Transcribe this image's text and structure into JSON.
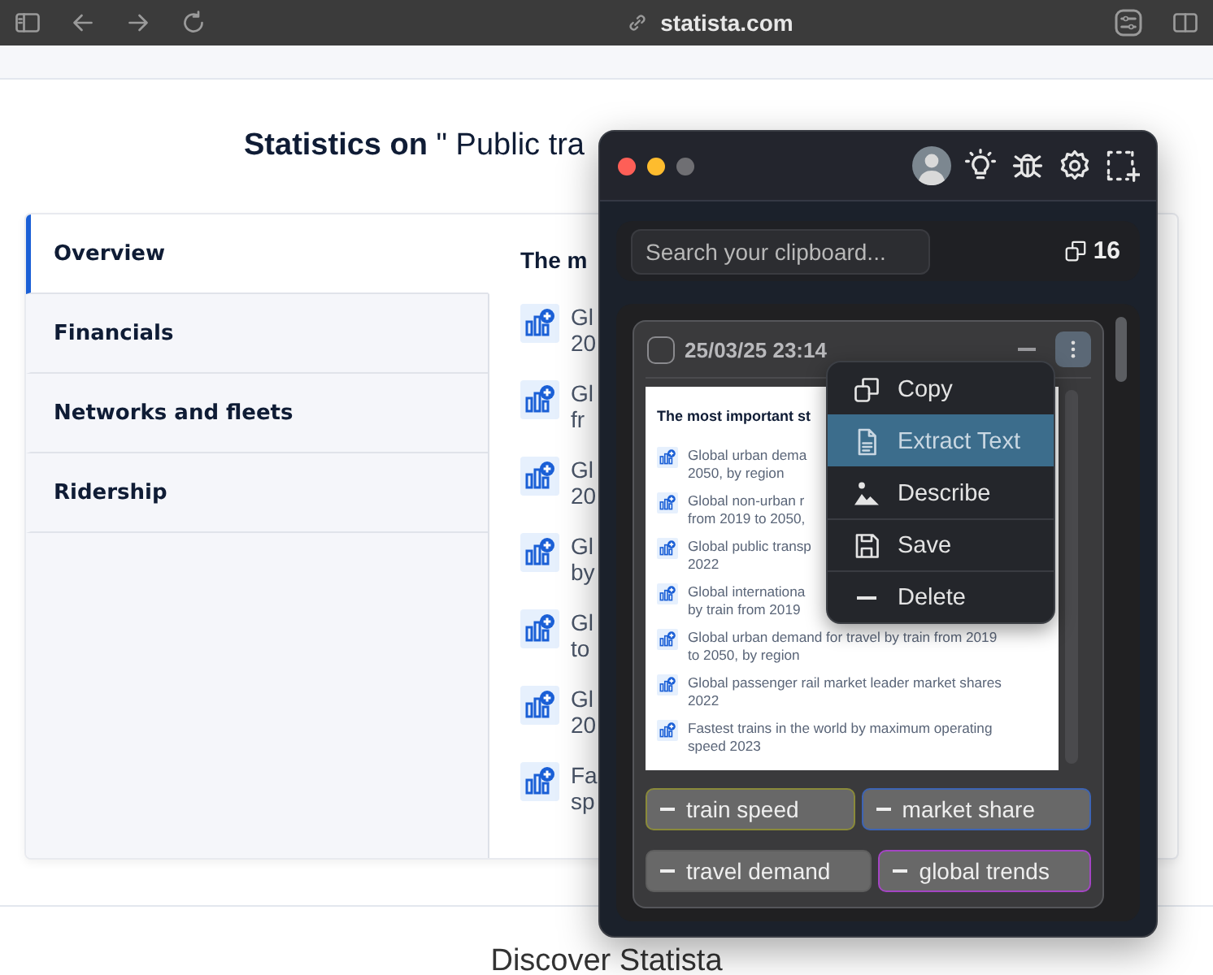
{
  "browser": {
    "url": "statista.com"
  },
  "page": {
    "title": "**Statistics on** \" Public tra",
    "content_heading": "The m",
    "footer_heading": "Discover Statista"
  },
  "tabs": [
    {
      "label": "Overview",
      "selected": true
    },
    {
      "label": "Financials",
      "selected": false
    },
    {
      "label": "Networks and fleets",
      "selected": false
    },
    {
      "label": "Ridership",
      "selected": false
    }
  ],
  "content_items": [
    {
      "lines": [
        "Gl",
        "20"
      ]
    },
    {
      "lines": [
        "Gl",
        "fr"
      ]
    },
    {
      "lines": [
        "Gl",
        "20"
      ]
    },
    {
      "lines": [
        "Gl",
        "by"
      ]
    },
    {
      "lines": [
        "Gl",
        "to"
      ]
    },
    {
      "lines": [
        "Gl",
        "20"
      ]
    },
    {
      "lines": [
        "Fa",
        "sp"
      ]
    }
  ],
  "clipboard": {
    "search": {
      "placeholder": "Search your clipboard..."
    },
    "count": "16",
    "entry": {
      "checked": false,
      "timestamp": "25/03/25 23:14",
      "preview": {
        "heading": "The most important st",
        "items": [
          {
            "lines": [
              "Global urban dema",
              "2050, by region"
            ]
          },
          {
            "lines": [
              "Global non-urban r",
              "from 2019 to 2050,"
            ]
          },
          {
            "lines": [
              "Global public transp",
              "2022"
            ]
          },
          {
            "lines": [
              "Global internationa",
              "by train from 2019"
            ]
          },
          {
            "lines": [
              "Global urban demand for travel by train from 2019",
              "to 2050, by region"
            ]
          },
          {
            "lines": [
              "Global passenger rail market leader market shares",
              "2022"
            ]
          },
          {
            "lines": [
              "Fastest trains in the world by maximum operating",
              "speed 2023"
            ]
          }
        ]
      }
    },
    "menu": [
      {
        "kind": "copy",
        "label": "Copy",
        "selected": false
      },
      {
        "kind": "extract",
        "label": "Extract Text",
        "selected": true
      },
      {
        "kind": "describe",
        "label": "Describe",
        "selected": false
      },
      {
        "kind": "save",
        "label": "Save",
        "selected": false
      },
      {
        "kind": "delete",
        "label": "Delete",
        "selected": false
      }
    ],
    "tags": [
      {
        "label": "train speed",
        "color": "#8a8a3a"
      },
      {
        "label": "market share",
        "color": "#3d64b4"
      },
      {
        "label": "travel demand",
        "color": "#5e5e5e"
      },
      {
        "label": "global trends",
        "color": "#a445c4"
      }
    ]
  }
}
